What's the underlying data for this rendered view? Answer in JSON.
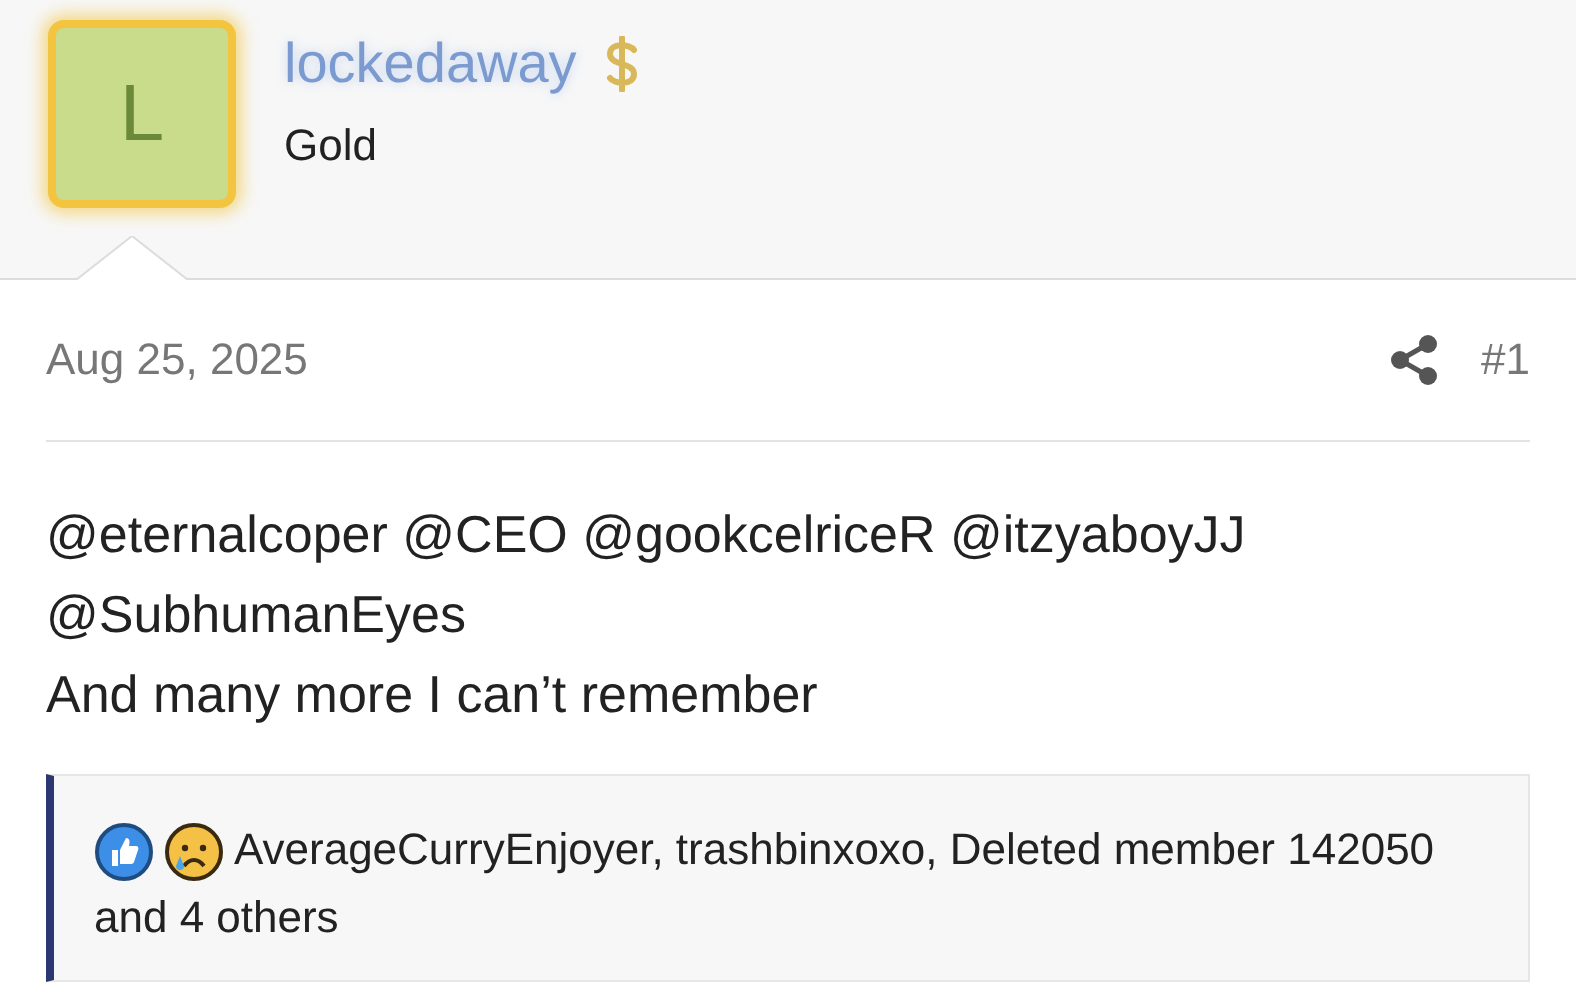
{
  "author": {
    "avatar_letter": "L",
    "username": "lockedaway",
    "title": "Gold"
  },
  "post": {
    "date": "Aug 25, 2025",
    "number": "#1",
    "lines": [
      "@eternalcoper @CEO @gookcelriceR @itzyaboyJJ",
      "@SubhumanEyes",
      "And many more I can’t remember"
    ]
  },
  "reactions": {
    "kinds": [
      {
        "kind": "like"
      },
      {
        "kind": "sad"
      }
    ],
    "lines": [
      "AverageCurryEnjoyer, trashbinxoxo, Deleted member 142050",
      "and 4 others"
    ]
  }
}
